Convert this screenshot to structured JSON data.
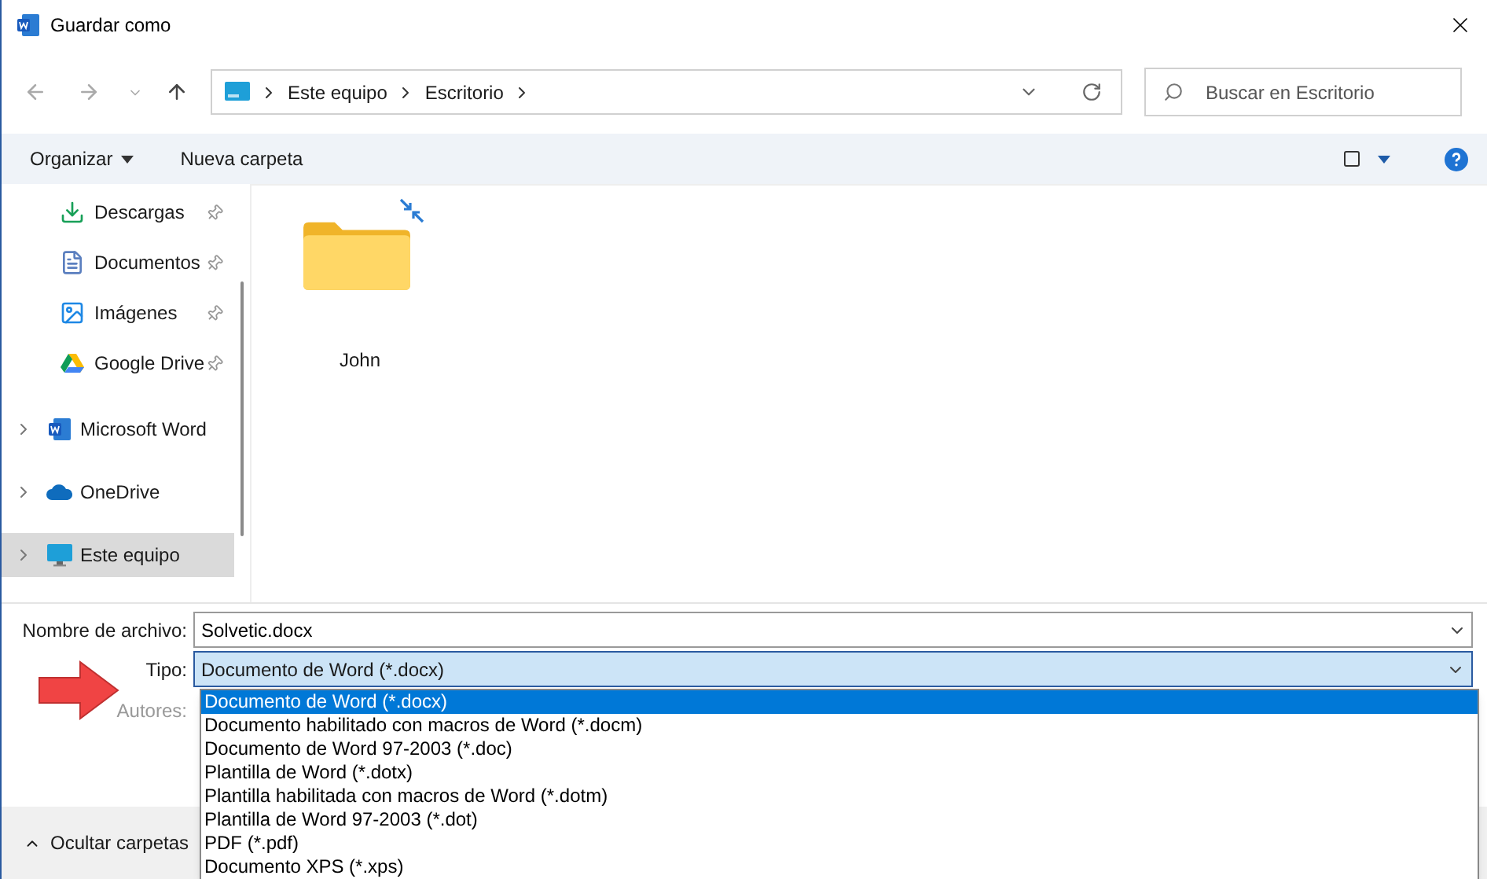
{
  "window": {
    "title": "Guardar como"
  },
  "address": {
    "crumbs": [
      "Este equipo",
      "Escritorio"
    ]
  },
  "search": {
    "placeholder": "Buscar en Escritorio"
  },
  "toolbar": {
    "organize": "Organizar",
    "new_folder": "Nueva carpeta"
  },
  "sidebar": {
    "items": [
      {
        "kind": "quick",
        "label": "Descargas",
        "pinned": true,
        "selected": false
      },
      {
        "kind": "quick",
        "label": "Documentos",
        "pinned": true,
        "selected": false
      },
      {
        "kind": "quick",
        "label": "Imágenes",
        "pinned": true,
        "selected": false
      },
      {
        "kind": "quick",
        "label": "Google Drive",
        "pinned": true,
        "selected": false
      },
      {
        "kind": "root",
        "label": "Microsoft Word",
        "selected": false
      },
      {
        "kind": "root",
        "label": "OneDrive",
        "selected": false
      },
      {
        "kind": "root",
        "label": "Este equipo",
        "selected": true
      }
    ]
  },
  "files": [
    {
      "name": "John"
    }
  ],
  "form": {
    "filename_label": "Nombre de archivo:",
    "filename": "Solvetic.docx",
    "type_label": "Tipo:",
    "type_value": "Documento de Word (*.docx)",
    "authors_label": "Autores:"
  },
  "type_options": [
    {
      "label": "Documento de Word (*.docx)",
      "selected": true
    },
    {
      "label": "Documento habilitado con macros de Word (*.docm)",
      "selected": false
    },
    {
      "label": "Documento de Word 97-2003 (*.doc)",
      "selected": false
    },
    {
      "label": "Plantilla de Word (*.dotx)",
      "selected": false
    },
    {
      "label": "Plantilla habilitada con macros de Word (*.dotm)",
      "selected": false
    },
    {
      "label": "Plantilla de Word 97-2003 (*.dot)",
      "selected": false
    },
    {
      "label": "PDF (*.pdf)",
      "selected": false
    },
    {
      "label": "Documento XPS (*.xps)",
      "selected": false
    }
  ],
  "footer": {
    "hide_folders": "Ocultar carpetas"
  }
}
